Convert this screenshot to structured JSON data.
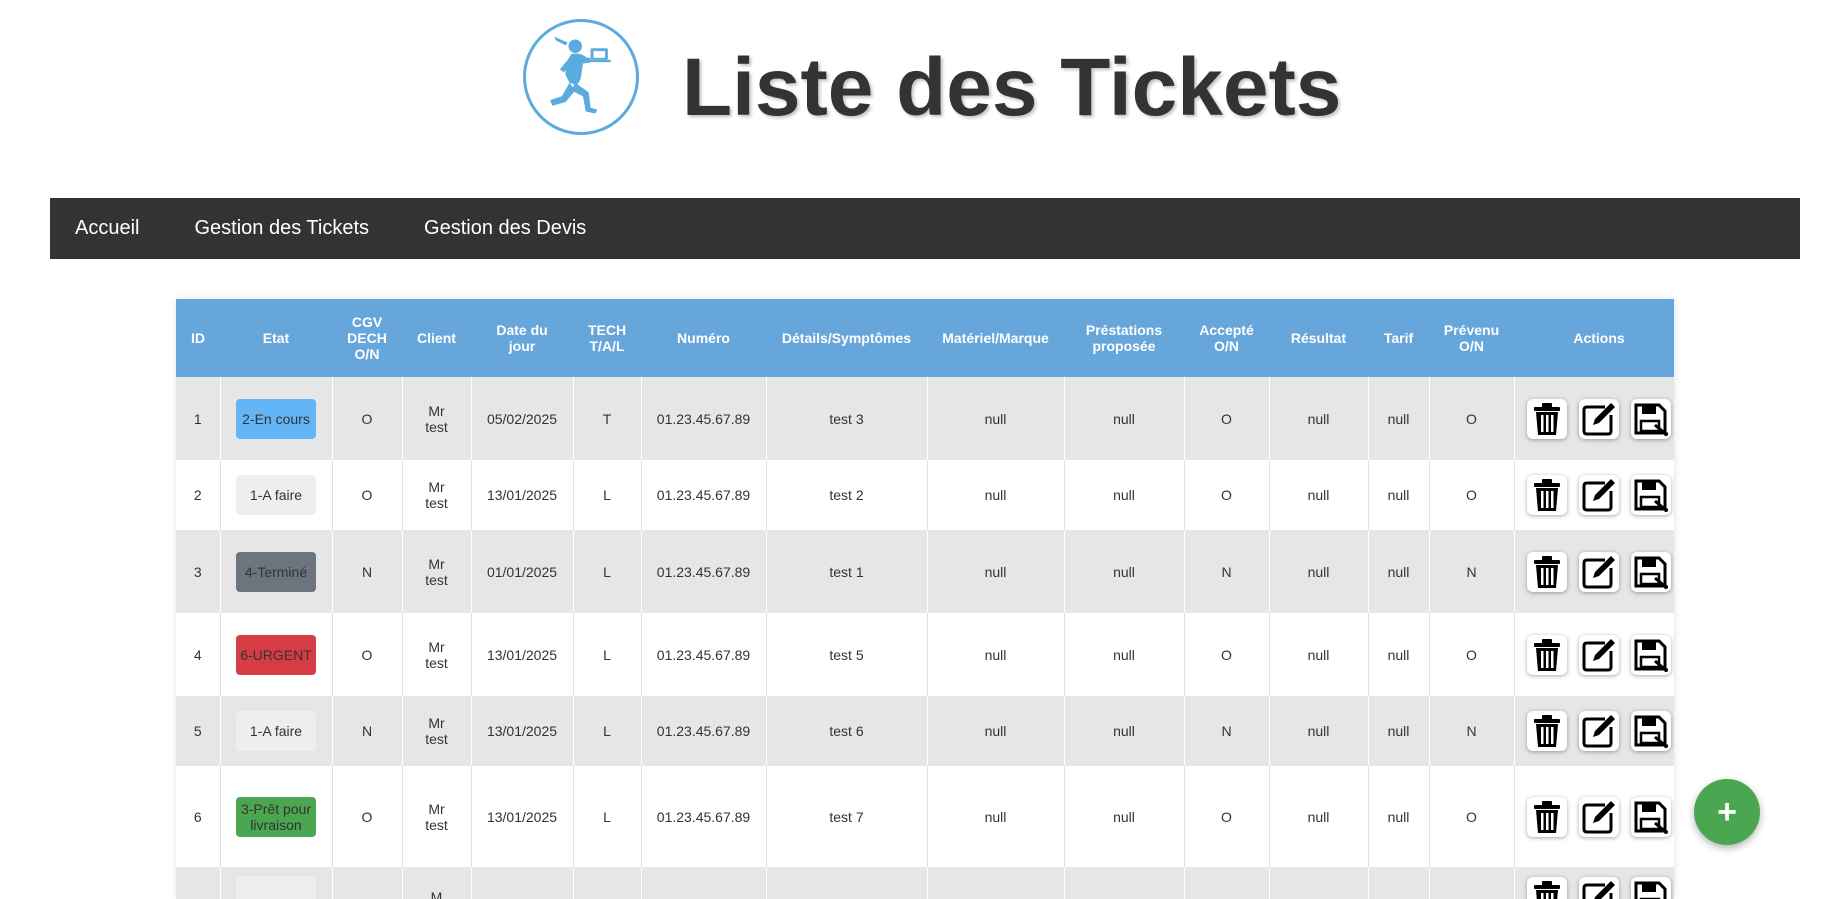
{
  "page": {
    "title": "Liste des Tickets"
  },
  "nav": {
    "items": [
      "Accueil",
      "Gestion des Tickets",
      "Gestion des Devis"
    ]
  },
  "table": {
    "headers": [
      "ID",
      "Etat",
      "CGV DECH O/N",
      "Client",
      "Date du jour",
      "TECH T/A/L",
      "Numéro",
      "Détails/Symptômes",
      "Matériel/Marque",
      "Préstations proposée",
      "Accepté O/N",
      "Résultat",
      "Tarif",
      "Prévenu O/N",
      "Actions"
    ],
    "rows": [
      {
        "id": "1",
        "etat": "2-En cours",
        "etat_color": "#64b5f6",
        "cgv": "O",
        "client": "Mr test",
        "date": "05/02/2025",
        "tech": "T",
        "numero": "01.23.45.67.89",
        "details": "test 3",
        "materiel": "null",
        "prestations": "null",
        "accepte": "O",
        "resultat": "null",
        "tarif": "null",
        "prevenu": "O"
      },
      {
        "id": "2",
        "etat": "1-A faire",
        "etat_color": "#eeeeee",
        "cgv": "O",
        "client": "Mr test",
        "date": "13/01/2025",
        "tech": "L",
        "numero": "01.23.45.67.89",
        "details": "test 2",
        "materiel": "null",
        "prestations": "null",
        "accepte": "O",
        "resultat": "null",
        "tarif": "null",
        "prevenu": "O"
      },
      {
        "id": "3",
        "etat": "4-Terminé",
        "etat_color": "#6c757d",
        "cgv": "N",
        "client": "Mr test",
        "date": "01/01/2025",
        "tech": "L",
        "numero": "01.23.45.67.89",
        "details": "test 1",
        "materiel": "null",
        "prestations": "null",
        "accepte": "N",
        "resultat": "null",
        "tarif": "null",
        "prevenu": "N"
      },
      {
        "id": "4",
        "etat": "6-URGENT",
        "etat_color": "#d63c43",
        "cgv": "O",
        "client": "Mr test",
        "date": "13/01/2025",
        "tech": "L",
        "numero": "01.23.45.67.89",
        "details": "test 5",
        "materiel": "null",
        "prestations": "null",
        "accepte": "O",
        "resultat": "null",
        "tarif": "null",
        "prevenu": "O"
      },
      {
        "id": "5",
        "etat": "1-A faire",
        "etat_color": "#eeeeee",
        "cgv": "N",
        "client": "Mr test",
        "date": "13/01/2025",
        "tech": "L",
        "numero": "01.23.45.67.89",
        "details": "test 6",
        "materiel": "null",
        "prestations": "null",
        "accepte": "N",
        "resultat": "null",
        "tarif": "null",
        "prevenu": "N"
      },
      {
        "id": "6",
        "etat": "3-Prêt pour livraison",
        "etat_color": "#4aa651",
        "cgv": "O",
        "client": "Mr test",
        "date": "13/01/2025",
        "tech": "L",
        "numero": "01.23.45.67.89",
        "details": "test 7",
        "materiel": "null",
        "prestations": "null",
        "accepte": "O",
        "resultat": "null",
        "tarif": "null",
        "prevenu": "O"
      },
      {
        "id": "",
        "etat": "",
        "etat_color": "#eeeeee",
        "cgv": "",
        "client": "M",
        "date": "",
        "tech": "",
        "numero": "",
        "details": "",
        "materiel": "",
        "prestations": "",
        "accepte": "",
        "resultat": "",
        "tarif": "",
        "prevenu": ""
      }
    ]
  },
  "actions": {
    "icons": [
      "trash-icon",
      "edit-icon",
      "save-icon"
    ]
  },
  "fab": {
    "label": "+"
  },
  "colors": {
    "navbar": "#333333",
    "table_header": "#67a6db",
    "logo": "#5aabdf",
    "fab": "#4aa651"
  }
}
